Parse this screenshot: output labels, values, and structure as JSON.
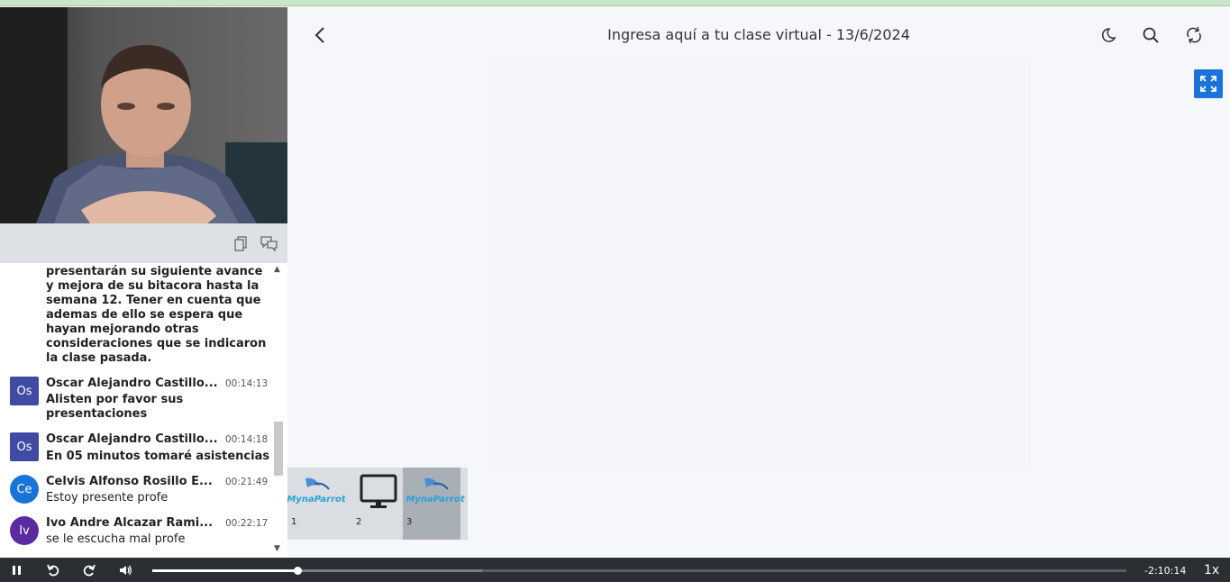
{
  "header": {
    "title": "Ingresa aquí a tu clase virtual - 13/6/2024"
  },
  "chat": {
    "continued_text": "presentarán su siguiente avance y mejora de su bitacora hasta la semana 12. Tener en cuenta que ademas de ello se espera que hayan mejorando otras consideraciones que se indicaron la clase pasada.",
    "messages": [
      {
        "initials": "Os",
        "name": "Oscar Alejandro Castillo...",
        "time": "00:14:13",
        "text": "Alisten por favor sus presentaciones",
        "color": "#3e4aa3"
      },
      {
        "initials": "Os",
        "name": "Oscar Alejandro Castillo...",
        "time": "00:14:18",
        "text": "En 05 minutos tomaré asistencias",
        "color": "#3e4aa3"
      },
      {
        "initials": "Ce",
        "name": "Celvis Alfonso Rosillo E...",
        "time": "00:21:49",
        "text": "Estoy presente profe",
        "color": "#1a73d9"
      },
      {
        "initials": "Iv",
        "name": "Ivo Andre Alcazar Rami...",
        "time": "00:22:17",
        "text": "se le escucha mal profe",
        "color": "#5a2aa0"
      }
    ]
  },
  "thumbnails": [
    {
      "num": "1",
      "logo": "MynaParrot"
    },
    {
      "num": "2",
      "logo": ""
    },
    {
      "num": "3",
      "logo": "MynaParrot"
    }
  ],
  "player": {
    "time_remaining": "-2:10:14",
    "speed": "1x",
    "progress_fraction": 0.149
  }
}
